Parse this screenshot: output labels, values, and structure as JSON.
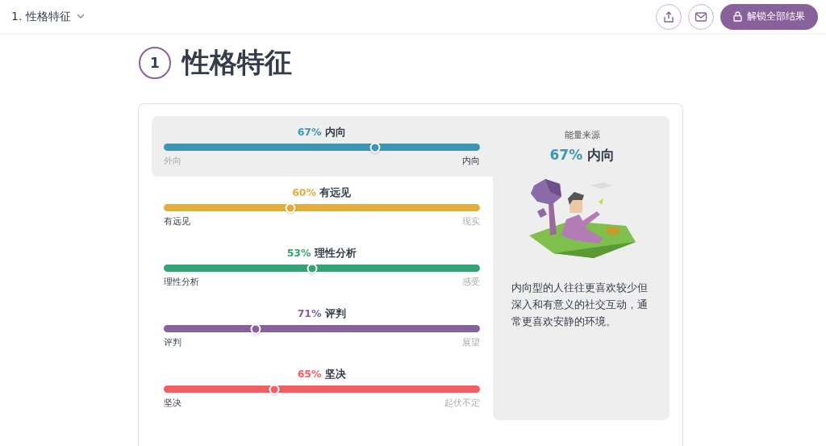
{
  "header": {
    "section_menu": "1. 性格特征",
    "unlock_button": "解锁全部结果"
  },
  "section": {
    "number": "1",
    "title": "性格特征"
  },
  "traits": [
    {
      "percent": "67%",
      "name": "内向",
      "color": "#3f96b4",
      "level": 0.67,
      "selected": true,
      "left_label": "外向",
      "left_active": false,
      "right_label": "内向",
      "right_active": true
    },
    {
      "percent": "60%",
      "name": "有远见",
      "color": "#e4ae3c",
      "level": 0.4,
      "selected": false,
      "left_label": "有远见",
      "left_active": true,
      "right_label": "现实",
      "right_active": false
    },
    {
      "percent": "53%",
      "name": "理性分析",
      "color": "#33a474",
      "level": 0.47,
      "selected": false,
      "left_label": "理性分析",
      "left_active": true,
      "right_label": "感受",
      "right_active": false
    },
    {
      "percent": "71%",
      "name": "评判",
      "color": "#88619a",
      "level": 0.29,
      "selected": false,
      "left_label": "评判",
      "left_active": true,
      "right_label": "展望",
      "right_active": false
    },
    {
      "percent": "65%",
      "name": "坚决",
      "color": "#f25e62",
      "level": 0.35,
      "selected": false,
      "left_label": "坚决",
      "left_active": true,
      "right_label": "起伏不定",
      "right_active": false
    }
  ],
  "detail": {
    "heading": "能量来源",
    "percent": "67%",
    "name": "内向",
    "color": "#3f96b4",
    "description": "内向型的人往往更喜欢较少但深入和有意义的社交互动，通常更喜欢安静的环境。"
  }
}
